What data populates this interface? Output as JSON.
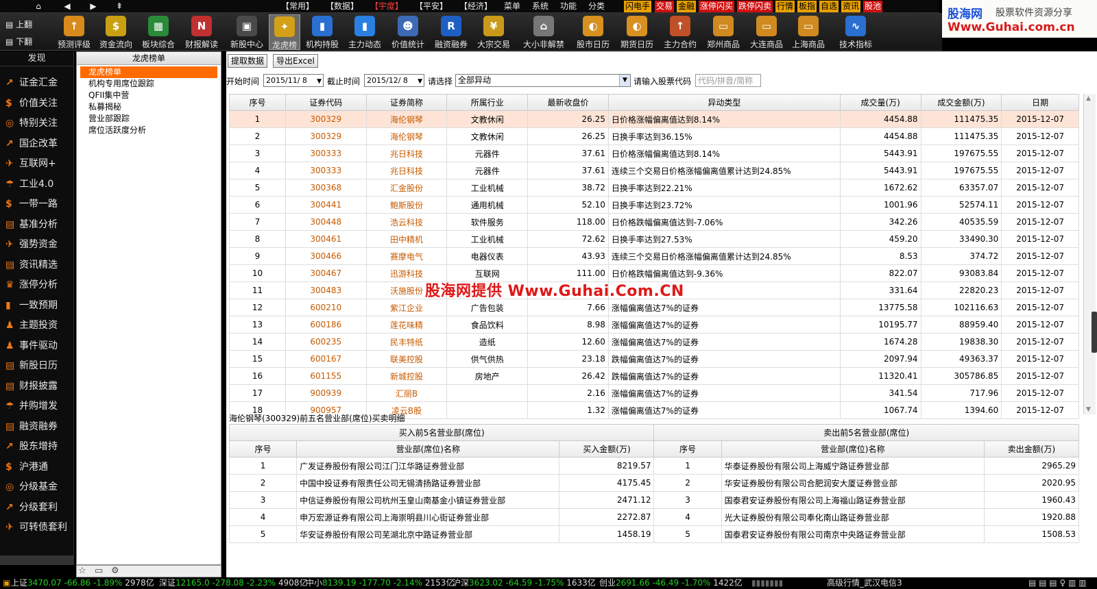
{
  "topmenu": {
    "items": [
      "【常用】",
      "【数据】",
      "【宇度】",
      "【平安】",
      "【经济】",
      "菜单",
      "系统",
      "功能",
      "分类"
    ],
    "quick": [
      "闪电手",
      "交易",
      "金融",
      "涨停闪买",
      "跌停闪卖",
      "行情",
      "板指",
      "自选",
      "资讯",
      "股池"
    ]
  },
  "logo": {
    "line1": "股海网",
    "line2": "股票软件资源分享",
    "line3": "Www.Guhai.com.cn"
  },
  "toolbar": {
    "page_up": "上翻",
    "page_down": "下翻",
    "tools": [
      {
        "label": "预测评级",
        "icon": "↑",
        "color": "#d88a1a"
      },
      {
        "label": "资金流向",
        "icon": "$",
        "color": "#c9a011"
      },
      {
        "label": "板块综合",
        "icon": "▦",
        "color": "#2a8a3a"
      },
      {
        "label": "财报解读",
        "icon": "N",
        "color": "#c03030"
      },
      {
        "label": "新股中心",
        "icon": "▣",
        "color": "#4a4a4a"
      },
      {
        "label": "龙虎榜",
        "icon": "✦",
        "color": "#d4a017"
      },
      {
        "label": "机构持股",
        "icon": "▮",
        "color": "#2b6fd0"
      },
      {
        "label": "主力动态",
        "icon": "▮",
        "color": "#2b7fe0"
      },
      {
        "label": "价值统计",
        "icon": "☻",
        "color": "#3d6ab5"
      },
      {
        "label": "融资融券",
        "icon": "R",
        "color": "#1e5fc4"
      },
      {
        "label": "大宗交易",
        "icon": "¥",
        "color": "#c99a1a"
      },
      {
        "label": "大小非解禁",
        "icon": "⌂",
        "color": "#777"
      },
      {
        "label": "股市日历",
        "icon": "◐",
        "color": "#d89020"
      },
      {
        "label": "期货日历",
        "icon": "◐",
        "color": "#d89020"
      },
      {
        "label": "主力合约",
        "icon": "↑",
        "color": "#c05028"
      },
      {
        "label": "郑州商品",
        "icon": "▭",
        "color": "#d08a20"
      },
      {
        "label": "大连商品",
        "icon": "▭",
        "color": "#d08a20"
      },
      {
        "label": "上海商品",
        "icon": "▭",
        "color": "#d08a20"
      },
      {
        "label": "技术指标",
        "icon": "∿",
        "color": "#2b6fd0"
      }
    ]
  },
  "leftnav": {
    "header": "发现",
    "items": [
      {
        "label": "证金汇金",
        "icon": "↗"
      },
      {
        "label": "价值关注",
        "icon": "$"
      },
      {
        "label": "特别关注",
        "icon": "◎"
      },
      {
        "label": "国企改革",
        "icon": "↗"
      },
      {
        "label": "互联网+",
        "icon": "✈"
      },
      {
        "label": "工业4.0",
        "icon": "☂"
      },
      {
        "label": "一带一路",
        "icon": "$"
      },
      {
        "label": "基准分析",
        "icon": "▤"
      },
      {
        "label": "强势资金",
        "icon": "✈"
      },
      {
        "label": "资讯精选",
        "icon": "▤"
      },
      {
        "label": "涨停分析",
        "icon": "♛"
      },
      {
        "label": "一致预期",
        "icon": "▮"
      },
      {
        "label": "主题投资",
        "icon": "♟"
      },
      {
        "label": "事件驱动",
        "icon": "♟"
      },
      {
        "label": "新股日历",
        "icon": "▤"
      },
      {
        "label": "财报披露",
        "icon": "▤"
      },
      {
        "label": "并购增发",
        "icon": "☂"
      },
      {
        "label": "融资融券",
        "icon": "▤"
      },
      {
        "label": "股东增持",
        "icon": "↗"
      },
      {
        "label": "沪港通",
        "icon": "$"
      },
      {
        "label": "分级基金",
        "icon": "◎"
      },
      {
        "label": "分级套利",
        "icon": "↗"
      },
      {
        "label": "可转债套利",
        "icon": "✈"
      }
    ]
  },
  "catpanel": {
    "title": "龙虎榜单",
    "items": [
      "龙虎榜单",
      "机构专用席位跟踪",
      "QFII集中营",
      "私募揭秘",
      "营业部跟踪",
      "席位活跃度分析"
    ]
  },
  "controls": {
    "fetch": "提取数据",
    "export": "导出Excel",
    "start_label": "开始时间",
    "start_value": "2015/11/ 8",
    "end_label": "截止时间",
    "end_value": "2015/12/ 8",
    "select_label": "请选择",
    "select_value": "全部异动",
    "code_label": "请输入股票代码",
    "code_placeholder": "代码/拼音/简称"
  },
  "table": {
    "headers": [
      "序号",
      "证券代码",
      "证券简称",
      "所属行业",
      "最新收盘价",
      "异动类型",
      "成交量(万)",
      "成交金额(万)",
      "日期"
    ],
    "rows": [
      [
        "1",
        "300329",
        "海伦钢琴",
        "文教休闲",
        "26.25",
        "日价格涨幅偏离值达到8.14%",
        "4454.88",
        "111475.35",
        "2015-12-07"
      ],
      [
        "2",
        "300329",
        "海伦钢琴",
        "文教休闲",
        "26.25",
        "日换手率达到36.15%",
        "4454.88",
        "111475.35",
        "2015-12-07"
      ],
      [
        "3",
        "300333",
        "兆日科技",
        "元器件",
        "37.61",
        "日价格涨幅偏离值达到8.14%",
        "5443.91",
        "197675.55",
        "2015-12-07"
      ],
      [
        "4",
        "300333",
        "兆日科技",
        "元器件",
        "37.61",
        "连续三个交易日价格涨幅偏离值累计达到24.85%",
        "5443.91",
        "197675.55",
        "2015-12-07"
      ],
      [
        "5",
        "300368",
        "汇金股份",
        "工业机械",
        "38.72",
        "日换手率达到22.21%",
        "1672.62",
        "63357.07",
        "2015-12-07"
      ],
      [
        "6",
        "300441",
        "鲍斯股份",
        "通用机械",
        "52.10",
        "日换手率达到23.72%",
        "1001.96",
        "52574.11",
        "2015-12-07"
      ],
      [
        "7",
        "300448",
        "浩云科技",
        "软件服务",
        "118.00",
        "日价格跌幅偏离值达到-7.06%",
        "342.26",
        "40535.59",
        "2015-12-07"
      ],
      [
        "8",
        "300461",
        "田中精机",
        "工业机械",
        "72.62",
        "日换手率达到27.53%",
        "459.20",
        "33490.30",
        "2015-12-07"
      ],
      [
        "9",
        "300466",
        "赛摩电气",
        "电器仪表",
        "43.93",
        "连续三个交易日价格涨幅偏离值累计达到24.85%",
        "8.53",
        "374.72",
        "2015-12-07"
      ],
      [
        "10",
        "300467",
        "迅游科技",
        "互联网",
        "111.00",
        "日价格跌幅偏离值达到-9.36%",
        "822.07",
        "93083.84",
        "2015-12-07"
      ],
      [
        "11",
        "300483",
        "沃施股份",
        "",
        "",
        "",
        "331.64",
        "22820.23",
        "2015-12-07"
      ],
      [
        "12",
        "600210",
        "紫江企业",
        "广告包装",
        "7.66",
        "涨幅偏离值达7%的证券",
        "13775.58",
        "102116.63",
        "2015-12-07"
      ],
      [
        "13",
        "600186",
        "莲花味精",
        "食品饮料",
        "8.98",
        "涨幅偏离值达7%的证券",
        "10195.77",
        "88959.40",
        "2015-12-07"
      ],
      [
        "14",
        "600235",
        "民丰特纸",
        "造纸",
        "12.60",
        "涨幅偏离值达7%的证券",
        "1674.28",
        "19838.30",
        "2015-12-07"
      ],
      [
        "15",
        "600167",
        "联美控股",
        "供气供热",
        "23.18",
        "跌幅偏离值达7%的证券",
        "2097.94",
        "49363.37",
        "2015-12-07"
      ],
      [
        "16",
        "601155",
        "新城控股",
        "房地产",
        "26.42",
        "跌幅偏离值达7%的证券",
        "11320.41",
        "305786.85",
        "2015-12-07"
      ],
      [
        "17",
        "900939",
        "汇丽B",
        "",
        "2.16",
        "涨幅偏离值达7%的证券",
        "341.54",
        "717.96",
        "2015-12-07"
      ],
      [
        "18",
        "900957",
        "凌云B股",
        "",
        "1.32",
        "涨幅偏离值达7%的证券",
        "1067.74",
        "1394.60",
        "2015-12-07"
      ]
    ]
  },
  "watermark": "股海网提供 Www.Guhai.Com.CN",
  "detail": {
    "title": "海伦钢琴(300329)前五名营业部(席位)买卖明细",
    "buy_title": "买入前5名营业部(席位)",
    "sell_title": "卖出前5名营业部(席位)",
    "headers": [
      "序号",
      "营业部(席位)名称",
      "买入金额(万)",
      "序号",
      "营业部(席位)名称",
      "卖出金额(万)"
    ],
    "rows": [
      [
        "1",
        "广发证券股份有限公司江门江华路证券营业部",
        "8219.57",
        "1",
        "华泰证券股份有限公司上海威宁路证券营业部",
        "2965.29"
      ],
      [
        "2",
        "中国中投证券有限责任公司无锡清扬路证券营业部",
        "4175.45",
        "2",
        "华安证券股份有限公司合肥润安大厦证券营业部",
        "2020.95"
      ],
      [
        "3",
        "中信证券股份有限公司杭州玉皇山南基金小镇证券营业部",
        "2471.12",
        "3",
        "国泰君安证券股份有限公司上海福山路证券营业部",
        "1960.43"
      ],
      [
        "4",
        "申万宏源证券有限公司上海崇明县川心街证券营业部",
        "2272.87",
        "4",
        "光大证券股份有限公司奉化南山路证券营业部",
        "1920.88"
      ],
      [
        "5",
        "华安证券股份有限公司芜湖北京中路证券营业部",
        "1458.19",
        "5",
        "国泰君安证券股份有限公司南京中央路证券营业部",
        "1508.53"
      ]
    ]
  },
  "statusbar": {
    "sh": {
      "name": "上证",
      "value": "3470.07",
      "change": "-66.86",
      "pct": "-1.89%",
      "vol": "2978亿"
    },
    "sz": {
      "name": "深证",
      "value": "12165.0",
      "change": "-278.08",
      "pct": "-2.23%",
      "vol": "4908亿"
    },
    "zx": {
      "name": "中小",
      "value": "8139.19",
      "change": "-177.70",
      "pct": "-2.14%",
      "vol": "2153亿"
    },
    "hs": {
      "name": "沪深",
      "value": "3623.02",
      "change": "-64.59",
      "pct": "-1.75%",
      "vol": "1633亿"
    },
    "cy": {
      "name": "创业",
      "value": "2691.66",
      "change": "-46.49",
      "pct": "-1.70%",
      "vol": "1422亿"
    },
    "server": "高级行情_武汉电信3"
  },
  "colors": {
    "accent": "#ff6a00",
    "down": "#22d022",
    "up": "#ff3b3b",
    "code": "#c65a00"
  }
}
